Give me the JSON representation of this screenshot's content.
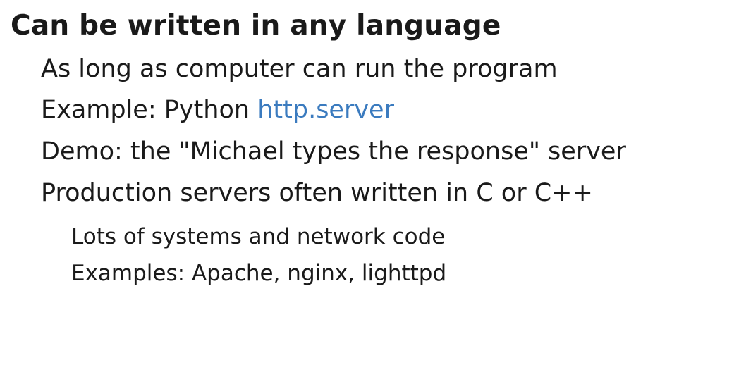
{
  "title": "Can be written in any language",
  "bullets": [
    {
      "text": "As long as computer can run the program"
    },
    {
      "prefix": "Example: Python ",
      "link_text": "http.server"
    },
    {
      "text": "Demo: the \"Michael types the response\" server"
    },
    {
      "text": "Production servers often written in C or C++"
    }
  ],
  "sub_bullets": [
    {
      "text": "Lots of systems and network code"
    },
    {
      "text": "Examples: Apache, nginx, lighttpd"
    }
  ],
  "colors": {
    "text": "#1a1a1a",
    "link": "#3b7bbf",
    "background": "#ffffff"
  }
}
